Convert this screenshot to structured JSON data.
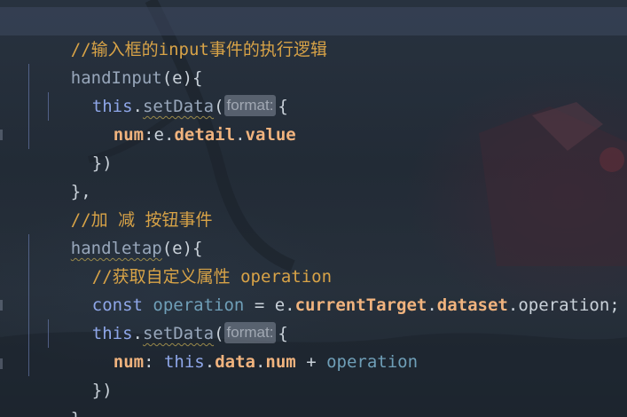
{
  "code_lines": [
    {
      "comment": "//输入框的input事件的执行逻辑"
    },
    {
      "method": "handInput",
      "args": "(e){"
    },
    {
      "this": "this",
      "dot": ".",
      "call": "setData",
      "open": "(",
      "hint": "format:",
      "brace": "{"
    },
    {
      "prop": "num",
      "colon": ":",
      "obj": "e",
      "dot1": ".",
      "prop2": "detail",
      "dot2": ".",
      "prop3": "value"
    },
    {
      "text": "})"
    },
    {
      "text": "},"
    },
    {
      "comment": "//加 减 按钮事件"
    },
    {
      "method": "handletap",
      "args": "(e){"
    },
    {
      "comment": "//获取自定义属性 operation"
    },
    {
      "kw": "const",
      "var": "operation",
      "eq": " = ",
      "obj": "e",
      "dot1": ".",
      "prop": "currentTarget",
      "dot2": ".",
      "prop2": "dataset",
      "dot3": ".",
      "tail": "operation;"
    },
    {
      "this": "this",
      "dot": ".",
      "call": "setData",
      "open": "(",
      "hint": "format:",
      "brace": "{"
    },
    {
      "prop": "num",
      "colon": ": ",
      "this": "this",
      "dot1": ".",
      "prop2": "data",
      "dot2": ".",
      "prop3": "num",
      "op": " + ",
      "var": "operation"
    },
    {
      "text": "})"
    },
    {
      "text": "},"
    }
  ],
  "colors": {
    "comment": "#d8a347",
    "keyword": "#8ea6e8",
    "property": "#f0b37e",
    "variable": "#6f9fb8",
    "line_highlight": "#3e4860"
  }
}
